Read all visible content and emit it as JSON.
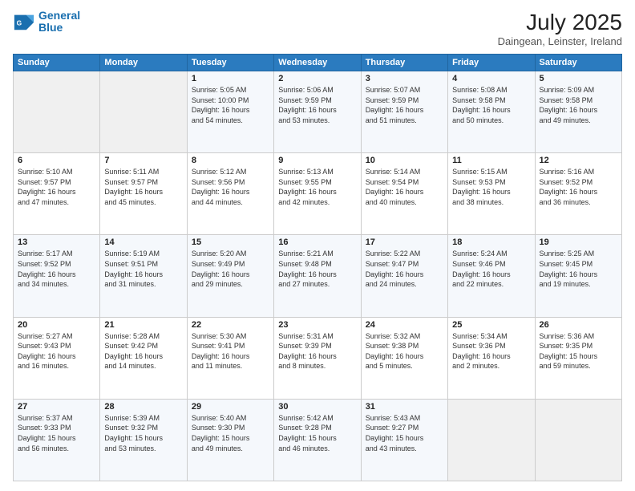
{
  "header": {
    "logo_line1": "General",
    "logo_line2": "Blue",
    "month_year": "July 2025",
    "location": "Daingean, Leinster, Ireland"
  },
  "weekdays": [
    "Sunday",
    "Monday",
    "Tuesday",
    "Wednesday",
    "Thursday",
    "Friday",
    "Saturday"
  ],
  "weeks": [
    [
      {
        "day": "",
        "content": ""
      },
      {
        "day": "",
        "content": ""
      },
      {
        "day": "1",
        "content": "Sunrise: 5:05 AM\nSunset: 10:00 PM\nDaylight: 16 hours\nand 54 minutes."
      },
      {
        "day": "2",
        "content": "Sunrise: 5:06 AM\nSunset: 9:59 PM\nDaylight: 16 hours\nand 53 minutes."
      },
      {
        "day": "3",
        "content": "Sunrise: 5:07 AM\nSunset: 9:59 PM\nDaylight: 16 hours\nand 51 minutes."
      },
      {
        "day": "4",
        "content": "Sunrise: 5:08 AM\nSunset: 9:58 PM\nDaylight: 16 hours\nand 50 minutes."
      },
      {
        "day": "5",
        "content": "Sunrise: 5:09 AM\nSunset: 9:58 PM\nDaylight: 16 hours\nand 49 minutes."
      }
    ],
    [
      {
        "day": "6",
        "content": "Sunrise: 5:10 AM\nSunset: 9:57 PM\nDaylight: 16 hours\nand 47 minutes."
      },
      {
        "day": "7",
        "content": "Sunrise: 5:11 AM\nSunset: 9:57 PM\nDaylight: 16 hours\nand 45 minutes."
      },
      {
        "day": "8",
        "content": "Sunrise: 5:12 AM\nSunset: 9:56 PM\nDaylight: 16 hours\nand 44 minutes."
      },
      {
        "day": "9",
        "content": "Sunrise: 5:13 AM\nSunset: 9:55 PM\nDaylight: 16 hours\nand 42 minutes."
      },
      {
        "day": "10",
        "content": "Sunrise: 5:14 AM\nSunset: 9:54 PM\nDaylight: 16 hours\nand 40 minutes."
      },
      {
        "day": "11",
        "content": "Sunrise: 5:15 AM\nSunset: 9:53 PM\nDaylight: 16 hours\nand 38 minutes."
      },
      {
        "day": "12",
        "content": "Sunrise: 5:16 AM\nSunset: 9:52 PM\nDaylight: 16 hours\nand 36 minutes."
      }
    ],
    [
      {
        "day": "13",
        "content": "Sunrise: 5:17 AM\nSunset: 9:52 PM\nDaylight: 16 hours\nand 34 minutes."
      },
      {
        "day": "14",
        "content": "Sunrise: 5:19 AM\nSunset: 9:51 PM\nDaylight: 16 hours\nand 31 minutes."
      },
      {
        "day": "15",
        "content": "Sunrise: 5:20 AM\nSunset: 9:49 PM\nDaylight: 16 hours\nand 29 minutes."
      },
      {
        "day": "16",
        "content": "Sunrise: 5:21 AM\nSunset: 9:48 PM\nDaylight: 16 hours\nand 27 minutes."
      },
      {
        "day": "17",
        "content": "Sunrise: 5:22 AM\nSunset: 9:47 PM\nDaylight: 16 hours\nand 24 minutes."
      },
      {
        "day": "18",
        "content": "Sunrise: 5:24 AM\nSunset: 9:46 PM\nDaylight: 16 hours\nand 22 minutes."
      },
      {
        "day": "19",
        "content": "Sunrise: 5:25 AM\nSunset: 9:45 PM\nDaylight: 16 hours\nand 19 minutes."
      }
    ],
    [
      {
        "day": "20",
        "content": "Sunrise: 5:27 AM\nSunset: 9:43 PM\nDaylight: 16 hours\nand 16 minutes."
      },
      {
        "day": "21",
        "content": "Sunrise: 5:28 AM\nSunset: 9:42 PM\nDaylight: 16 hours\nand 14 minutes."
      },
      {
        "day": "22",
        "content": "Sunrise: 5:30 AM\nSunset: 9:41 PM\nDaylight: 16 hours\nand 11 minutes."
      },
      {
        "day": "23",
        "content": "Sunrise: 5:31 AM\nSunset: 9:39 PM\nDaylight: 16 hours\nand 8 minutes."
      },
      {
        "day": "24",
        "content": "Sunrise: 5:32 AM\nSunset: 9:38 PM\nDaylight: 16 hours\nand 5 minutes."
      },
      {
        "day": "25",
        "content": "Sunrise: 5:34 AM\nSunset: 9:36 PM\nDaylight: 16 hours\nand 2 minutes."
      },
      {
        "day": "26",
        "content": "Sunrise: 5:36 AM\nSunset: 9:35 PM\nDaylight: 15 hours\nand 59 minutes."
      }
    ],
    [
      {
        "day": "27",
        "content": "Sunrise: 5:37 AM\nSunset: 9:33 PM\nDaylight: 15 hours\nand 56 minutes."
      },
      {
        "day": "28",
        "content": "Sunrise: 5:39 AM\nSunset: 9:32 PM\nDaylight: 15 hours\nand 53 minutes."
      },
      {
        "day": "29",
        "content": "Sunrise: 5:40 AM\nSunset: 9:30 PM\nDaylight: 15 hours\nand 49 minutes."
      },
      {
        "day": "30",
        "content": "Sunrise: 5:42 AM\nSunset: 9:28 PM\nDaylight: 15 hours\nand 46 minutes."
      },
      {
        "day": "31",
        "content": "Sunrise: 5:43 AM\nSunset: 9:27 PM\nDaylight: 15 hours\nand 43 minutes."
      },
      {
        "day": "",
        "content": ""
      },
      {
        "day": "",
        "content": ""
      }
    ]
  ]
}
